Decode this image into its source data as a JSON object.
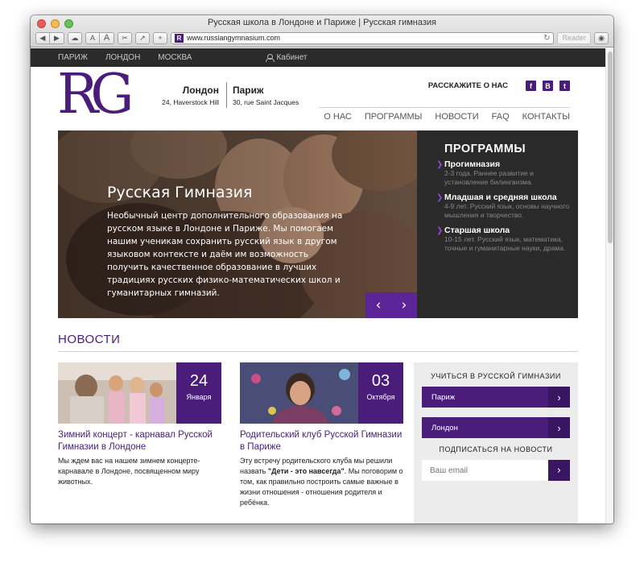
{
  "window": {
    "title": "Русская школа в Лондоне и Париже | Русская гимназия",
    "url": "www.russiangymnasium.com",
    "reader_label": "Reader",
    "toolbar": {
      "text_small": "A",
      "text_large": "A",
      "add": "+"
    }
  },
  "topbar": {
    "cities": [
      "ПАРИЖ",
      "ЛОНДОН",
      "МОСКВА"
    ],
    "cabinet": "Кабинет"
  },
  "header": {
    "logo": "RG",
    "london": {
      "city": "Лондон",
      "address": "24, Haverstock Hill"
    },
    "paris": {
      "city": "Париж",
      "address": "30, rue Saint Jacques"
    },
    "share_label": "РАССКАЖИТЕ О НАС",
    "social": [
      "f",
      "В",
      "t"
    ],
    "nav": [
      "О НАС",
      "ПРОГРАММЫ",
      "НОВОСТИ",
      "FAQ",
      "КОНТАКТЫ"
    ]
  },
  "hero": {
    "title": "Русская Гимназия",
    "text": "Необычный центр дополнительного образования на русском языке в Лондоне и Париже. Мы помогаем нашим ученикам сохранить русский язык в другом языковом контексте и даём им возможность получить качественное образование в лучших традициях русских физико-математических школ и гуманитарных гимназий.",
    "prev": "‹",
    "next": "›"
  },
  "programs": {
    "title": "ПРОГРАММЫ",
    "items": [
      {
        "title": "Прогимназия",
        "desc": "2-3 года. Раннее развитие и установление билингвизма."
      },
      {
        "title": "Младшая и средняя школа",
        "desc": "4-9 лет. Русский язык, основы научного мышления и творчество."
      },
      {
        "title": "Старшая школа",
        "desc": "10-15 лет. Русский язык, математика, точные и гуманитарные науки, драма."
      }
    ]
  },
  "news": {
    "title": "НОВОСТИ",
    "items": [
      {
        "day": "24",
        "month": "Января",
        "title": "Зимний концерт - карнавал Русской Гимназии в Лондоне",
        "text": "Мы ждем вас на нашем зимнем концерте-карнавале в Лондоне, посвященном миру животных."
      },
      {
        "day": "03",
        "month": "Октября",
        "title": "Родительский клуб Русской Гимназии в Париже",
        "text_prefix": "Эту встречу родительского клуба мы решили назвать ",
        "text_bold": "\"Дети - это навсегда\"",
        "text_suffix": ". Мы поговорим о том, как правильно построить самые важные в жизни отношения - отношения родителя и ребёнка."
      }
    ]
  },
  "sidebar": {
    "study_title": "УЧИТЬСЯ В РУССКОЙ ГИМНАЗИИ",
    "buttons": [
      "Париж",
      "Лондон"
    ],
    "subscribe_title": "ПОДПИСАТЬСЯ НА НОВОСТИ",
    "email_placeholder": "Ваш email",
    "arrow": "›"
  },
  "colors": {
    "brand": "#4a1d7a",
    "brand_dark": "#3a1562",
    "accent": "#5c2597",
    "dark": "#2a2a2a"
  }
}
